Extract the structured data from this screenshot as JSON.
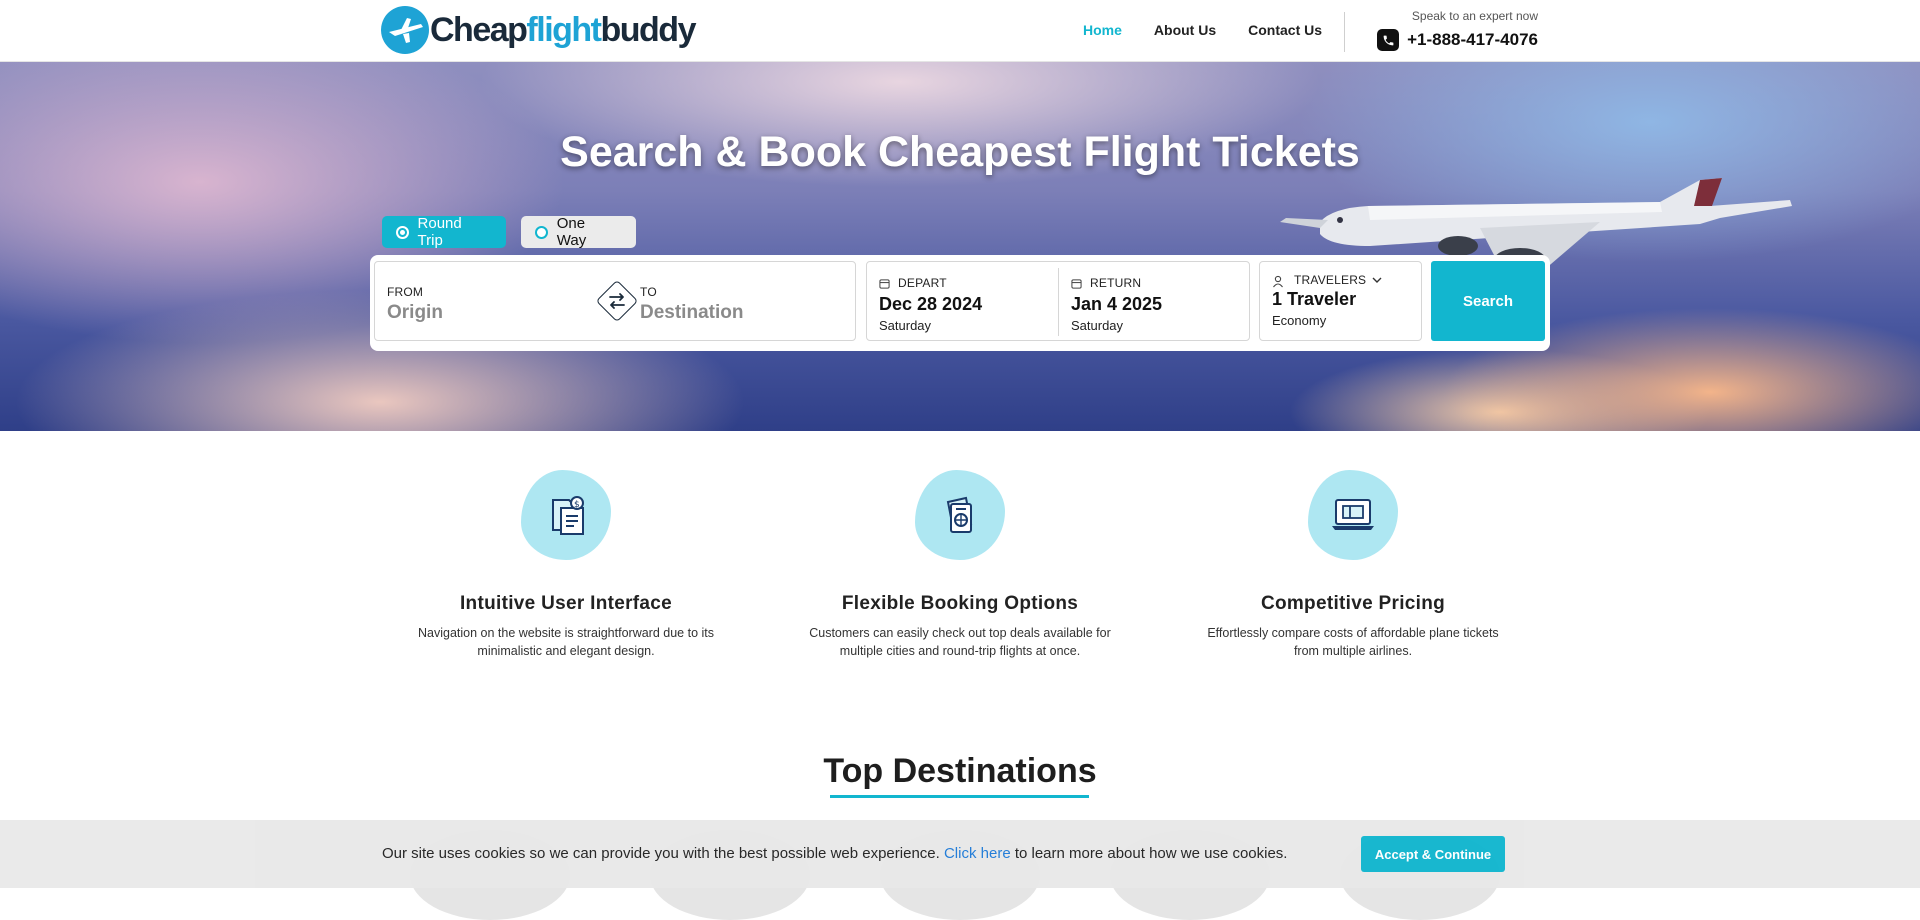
{
  "header": {
    "logo_part1": "Cheap",
    "logo_part2": "flight",
    "logo_part3": "buddy",
    "nav": [
      {
        "label": "Home",
        "active": true
      },
      {
        "label": "About Us",
        "active": false
      },
      {
        "label": "Contact Us",
        "active": false
      }
    ],
    "expert_text": "Speak to an expert now",
    "phone": "+1-888-417-4076"
  },
  "hero": {
    "title": "Search & Book Cheapest Flight Tickets",
    "trip_types": {
      "round_trip": "Round Trip",
      "one_way": "One Way",
      "selected": "Round Trip"
    },
    "from_label": "FROM",
    "from_placeholder": "Origin",
    "to_label": "TO",
    "to_placeholder": "Destination",
    "depart_label": "DEPART",
    "depart_date": "Dec 28 2024",
    "depart_day": "Saturday",
    "return_label": "RETURN",
    "return_date": "Jan 4 2025",
    "return_day": "Saturday",
    "travelers_label": "TRAVELERS",
    "travelers_value": "1 Traveler",
    "travel_class": "Economy",
    "search_label": "Search"
  },
  "features": [
    {
      "icon": "price-tag-document-icon",
      "title": "Intuitive User Interface",
      "desc_line1": "Navigation on the website is straightforward due to its",
      "desc_line2": "minimalistic and elegant design."
    },
    {
      "icon": "passport-ticket-icon",
      "title": "Flexible Booking Options",
      "desc_line1": "Customers can easily check out top deals available for",
      "desc_line2": "multiple cities and round-trip flights at once."
    },
    {
      "icon": "laptop-compare-icon",
      "title": "Competitive Pricing",
      "desc_line1": "Effortlessly compare costs of affordable plane tickets",
      "desc_line2": "from multiple airlines."
    }
  ],
  "destinations": {
    "title": "Top Destinations"
  },
  "cookie": {
    "text_before": "Our site uses cookies so we can provide you with the best possible web experience. ",
    "link": "Click here",
    "text_after": " to learn more about how we use cookies.",
    "button": "Accept & Continue"
  },
  "colors": {
    "accent": "#12b6cf",
    "logo_blue": "#1ea3d5",
    "link": "#1f7bd8"
  }
}
